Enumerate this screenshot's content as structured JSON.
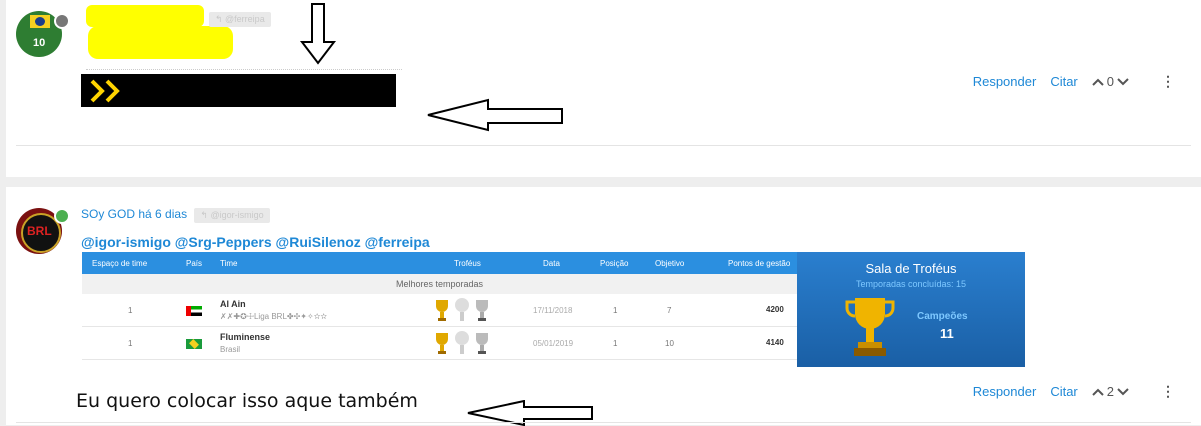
{
  "post1": {
    "reply_tag": "↰ @ferreipa",
    "avatar_text": "10",
    "actions": {
      "reply": "Responder",
      "quote": "Citar",
      "votes": "0"
    }
  },
  "post2": {
    "author": "SOy GOD",
    "time": "há 6 dias",
    "reply_tag": "↰ @igor-ismigo",
    "mentions": "@igor-ismigo @Srg-Peppers @RuiSilenoz @ferreipa",
    "avatar_text": "BRL",
    "actions": {
      "reply": "Responder",
      "quote": "Citar",
      "votes": "2"
    },
    "annotation": "Eu quero colocar isso aque também"
  },
  "trophy_table": {
    "headers": [
      "Espaço de time",
      "País",
      "Time",
      "Troféus",
      "Data",
      "Posição",
      "Objetivo",
      "Pontos de gestão"
    ],
    "section": "Melhores temporadas",
    "rows": [
      {
        "rank": "1",
        "team": "Al Ain",
        "sub": "✗✗✚✪☩Liga BRL✤✣✦✧✫✫",
        "date": "17/11/2018",
        "pos": "1",
        "obj": "7",
        "pts": "4200"
      },
      {
        "rank": "1",
        "team": "Fluminense",
        "sub": "Brasil",
        "date": "05/01/2019",
        "pos": "1",
        "obj": "10",
        "pts": "4140"
      }
    ]
  },
  "sala": {
    "title": "Sala de Troféus",
    "subtitle": "Temporadas concluídas: 15",
    "label": "Campeões",
    "count": "11"
  },
  "colors": {
    "link": "#1e88d6",
    "online": "#4caf50",
    "table_header": "#2b8fe0"
  }
}
